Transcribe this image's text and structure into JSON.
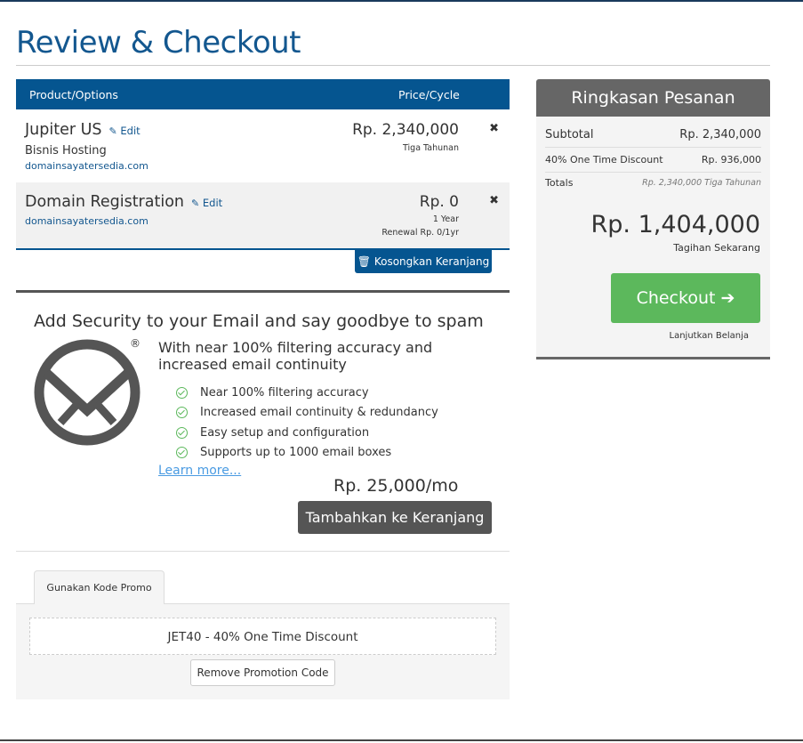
{
  "page": {
    "title": "Review & Checkout"
  },
  "cart": {
    "header": {
      "product": "Product/Options",
      "price": "Price/Cycle"
    },
    "items": [
      {
        "name": "Jupiter US",
        "edit": "Edit",
        "sub": "Bisnis Hosting",
        "domain": "domainsayatersedia.com",
        "price": "Rp. 2,340,000",
        "cycle": "Tiga Tahunan"
      },
      {
        "name": "Domain Registration",
        "edit": "Edit",
        "domain": "domainsayatersedia.com",
        "price": "Rp. 0",
        "cycle": "1 Year",
        "renewal": "Renewal Rp. 0/1yr"
      }
    ],
    "empty_label": "Kosongkan Keranjang"
  },
  "upsell": {
    "title": "Add Security to your Email and say goodbye to spam",
    "lead": "With near 100% filtering accuracy and increased email continuity",
    "features": [
      "Near 100% filtering accuracy",
      "Increased email continuity & redundancy",
      "Easy setup and configuration",
      "Supports up to 1000 email boxes"
    ],
    "learn_more": "Learn more...",
    "price": "Rp. 25,000/mo",
    "add_label": "Tambahkan ke Keranjang"
  },
  "promo": {
    "tab_label": "Gunakan Kode Promo",
    "code": "JET40 - 40% One Time Discount",
    "remove_label": "Remove Promotion Code"
  },
  "summary": {
    "title": "Ringkasan Pesanan",
    "subtotal_label": "Subtotal",
    "subtotal_value": "Rp. 2,340,000",
    "discount_label": "40% One Time Discount",
    "discount_value": "Rp. 936,000",
    "totals_label": "Totals",
    "totals_value": "Rp. 2,340,000 Tiga Tahunan",
    "total": "Rp. 1,404,000",
    "total_sub": "Tagihan Sekarang",
    "checkout_label": "Checkout",
    "continue_label": "Lanjutkan Belanja"
  },
  "colors": {
    "primary": "#055590",
    "success": "#5cb85c",
    "dark": "#555555",
    "title": "#13578f"
  }
}
